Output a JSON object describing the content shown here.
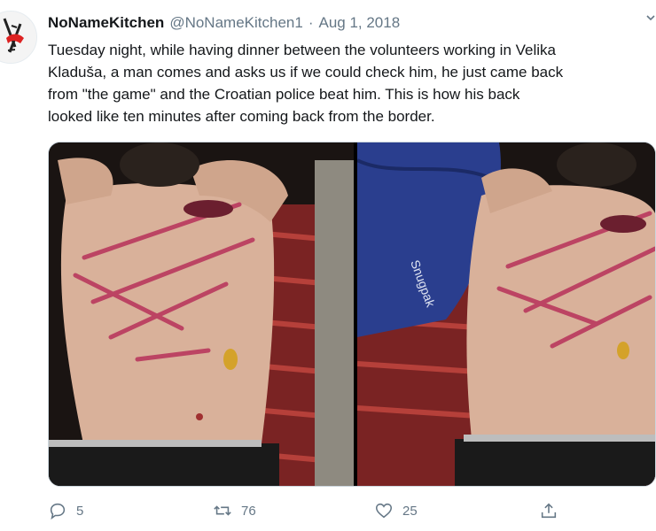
{
  "tweet": {
    "display_name": "NoNameKitchen",
    "handle": "@NoNameKitchen1",
    "separator": "·",
    "date": "Aug 1, 2018",
    "text": "Tuesday night, while having dinner between the volunteers working in Velika\nKladuša, a man comes and asks us if we could check him, he just came back\nfrom \"the game\" and the Croatian police beat him. This is how his back\nlooked like ten minutes after coming back from the border.",
    "sleeping_bag_text": "Snugpak"
  },
  "actions": {
    "reply_count": "5",
    "retweet_count": "76",
    "like_count": "25"
  },
  "icons": {
    "avatar": "no-name-kitchen-logo",
    "menu": "chevron-down-icon",
    "reply": "reply-icon",
    "retweet": "retweet-icon",
    "like": "heart-icon",
    "share": "share-icon"
  },
  "colors": {
    "text": "#14171a",
    "secondary": "#657786",
    "border": "#ccd6dd"
  }
}
